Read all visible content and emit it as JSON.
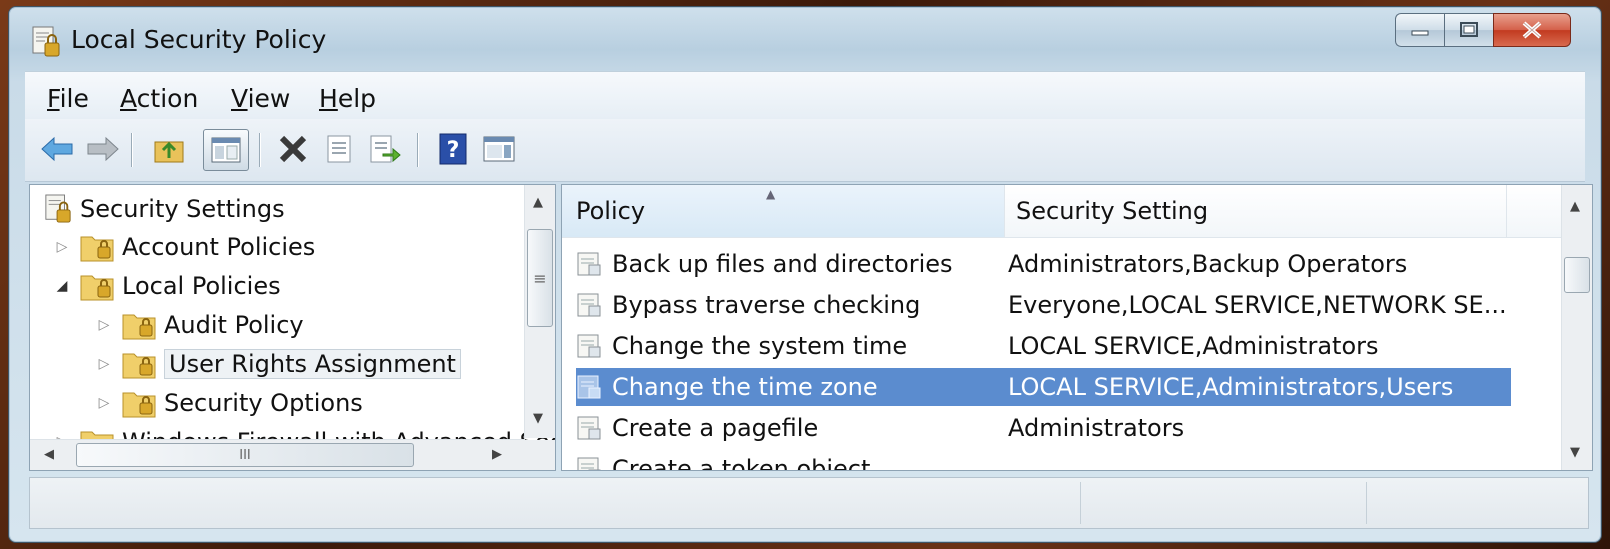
{
  "window": {
    "title": "Local Security Policy",
    "controls": {
      "minimize": "minimize",
      "maximize": "maximize",
      "close": "close"
    }
  },
  "menu": {
    "items": [
      {
        "label_pre": "",
        "label_u": "F",
        "label_post": "ile"
      },
      {
        "label_pre": "",
        "label_u": "A",
        "label_post": "ction"
      },
      {
        "label_pre": "",
        "label_u": "V",
        "label_post": "iew"
      },
      {
        "label_pre": "",
        "label_u": "H",
        "label_post": "elp"
      }
    ]
  },
  "toolbar": {
    "buttons": [
      "back-icon",
      "forward-icon",
      "up-folder-icon",
      "show-hide-tree-icon",
      "delete-icon",
      "properties-icon",
      "export-list-icon",
      "help-icon",
      "action-pane-icon"
    ]
  },
  "tree": {
    "root": "Security Settings",
    "items": [
      {
        "label": "Account Policies"
      },
      {
        "label": "Local Policies"
      },
      {
        "label": "Audit Policy"
      },
      {
        "label": "User Rights Assignment"
      },
      {
        "label": "Security Options"
      },
      {
        "label": "Windows Firewall with Advanced Security"
      }
    ],
    "scroll_thumb_glyph": "≡",
    "hscroll_thumb_glyph": "III"
  },
  "list": {
    "columns": {
      "policy": "Policy",
      "setting": "Security Setting"
    },
    "rows": [
      {
        "policy": "Back up files and directories",
        "setting": "Administrators,Backup Operators"
      },
      {
        "policy": "Bypass traverse checking",
        "setting": "Everyone,LOCAL SERVICE,NETWORK SE..."
      },
      {
        "policy": "Change the system time",
        "setting": "LOCAL SERVICE,Administrators"
      },
      {
        "policy": "Change the time zone",
        "setting": "LOCAL SERVICE,Administrators,Users"
      },
      {
        "policy": "Create a pagefile",
        "setting": "Administrators"
      },
      {
        "policy": "Create a token object",
        "setting": ""
      }
    ],
    "selected_index": 3
  },
  "colors": {
    "selection": "#5b8ccf",
    "window_chrome": "#c9dbe8",
    "close_button": "#c23a20"
  }
}
